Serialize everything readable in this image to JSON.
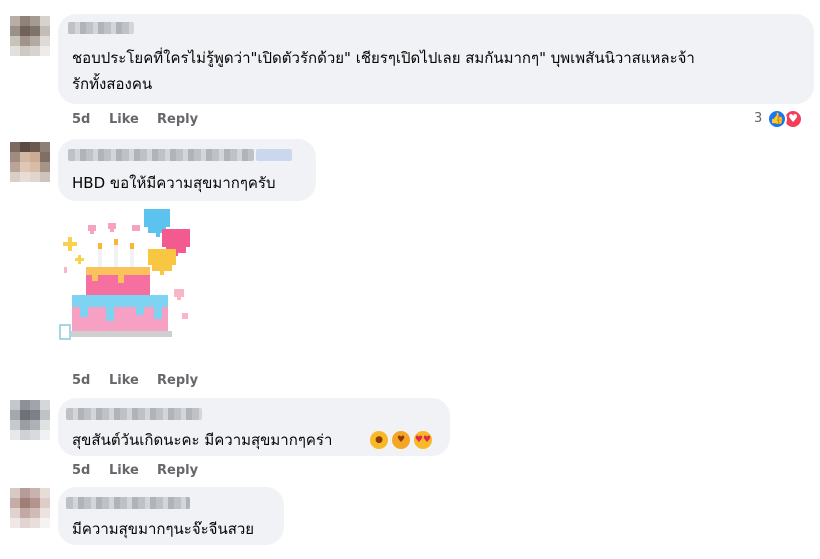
{
  "comments": [
    {
      "text_lines": [
        "ชอบประโยคที่ใครไม่รู้พูดว่า\"เปิดตัวรักด้วย\" เชียรๆเปิดไปเลย สมกันมากๆ\" บุพเพสันนิวาสแหละจ้า",
        "รักทั้งสองคน"
      ],
      "time": "5d",
      "like": "Like",
      "reply": "Reply",
      "reaction_count": "3",
      "reactions": [
        "like-icon",
        "love-icon"
      ]
    },
    {
      "text_lines": [
        "HBD ขอให้มีความสุขมากๆครับ"
      ],
      "sticker": "birthday-cake-sticker",
      "time": "5d",
      "like": "Like",
      "reply": "Reply"
    },
    {
      "text_lines": [
        "สุขสันต์วันเกิดนะคะ มีความสุขมากๆคร่า"
      ],
      "emojis": [
        "kissing-face",
        "smiling-face-with-hearts",
        "heart-eyes-face"
      ],
      "time": "5d",
      "like": "Like",
      "reply": "Reply"
    },
    {
      "text_lines": [
        "มีความสุขมากๆนะจ๊ะจีนสวย"
      ]
    }
  ],
  "colors": {
    "bubble": "#f0f2f5",
    "meta": "#65676b",
    "like_blue": "#1877f2",
    "love_red": "#f33e58"
  }
}
